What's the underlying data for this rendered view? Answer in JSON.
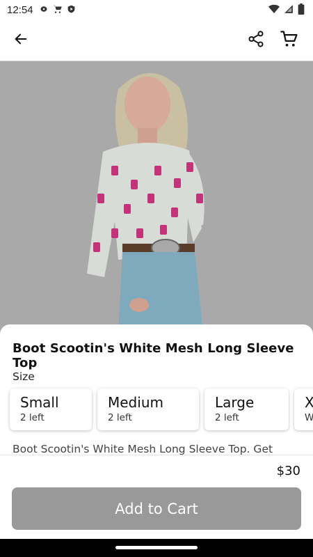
{
  "status_bar": {
    "time": "12:54",
    "left_icons": [
      "gear-icon",
      "cart-icon",
      "shield-icon"
    ],
    "right_icons": [
      "wifi-icon",
      "signal-icon",
      "battery-icon"
    ]
  },
  "app_bar": {
    "icons": [
      "arrow-left-icon",
      "share-icon",
      "cart-icon"
    ]
  },
  "product": {
    "title": "Boot Scootin's White Mesh Long Sleeve Top",
    "size_label": "Size",
    "sizes": [
      {
        "name": "Small",
        "stock": "2 left"
      },
      {
        "name": "Medium",
        "stock": "2 left"
      },
      {
        "name": "Large",
        "stock": "2 left"
      },
      {
        "name": "X",
        "stock": "W"
      }
    ],
    "description": "Boot Scootin's White Mesh Long Sleeve Top. Get",
    "price": "$30",
    "add_to_cart": "Add to Cart"
  },
  "colors": {
    "image_overlay": "#a9a9a9",
    "button_disabled": "#999999"
  }
}
